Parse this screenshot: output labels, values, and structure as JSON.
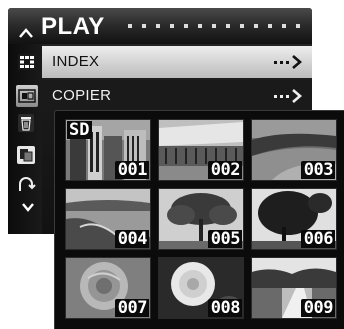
{
  "menu": {
    "title": "PLAY",
    "items": [
      {
        "label": "INDEX",
        "selected": true
      },
      {
        "label": "COPIER",
        "selected": false
      }
    ],
    "side_icons": [
      "trash-icon",
      "slideshow-icon",
      "rotate-icon"
    ]
  },
  "index_view": {
    "card_label": "SD",
    "thumbnails": [
      {
        "number": "001",
        "scene": "city-buildings"
      },
      {
        "number": "002",
        "scene": "stadium-building"
      },
      {
        "number": "003",
        "scene": "coastline"
      },
      {
        "number": "004",
        "scene": "lagoon-shore"
      },
      {
        "number": "005",
        "scene": "tree-silhouette"
      },
      {
        "number": "006",
        "scene": "tree-silhouette-dark"
      },
      {
        "number": "007",
        "scene": "rose-close-up"
      },
      {
        "number": "008",
        "scene": "white-rose"
      },
      {
        "number": "009",
        "scene": "garden-path"
      }
    ]
  },
  "colors": {
    "menu_background": "#1a1a1a",
    "selected_row": "#d8d8d8",
    "index_background": "#0b0b0b",
    "text_light": "#ffffff"
  }
}
